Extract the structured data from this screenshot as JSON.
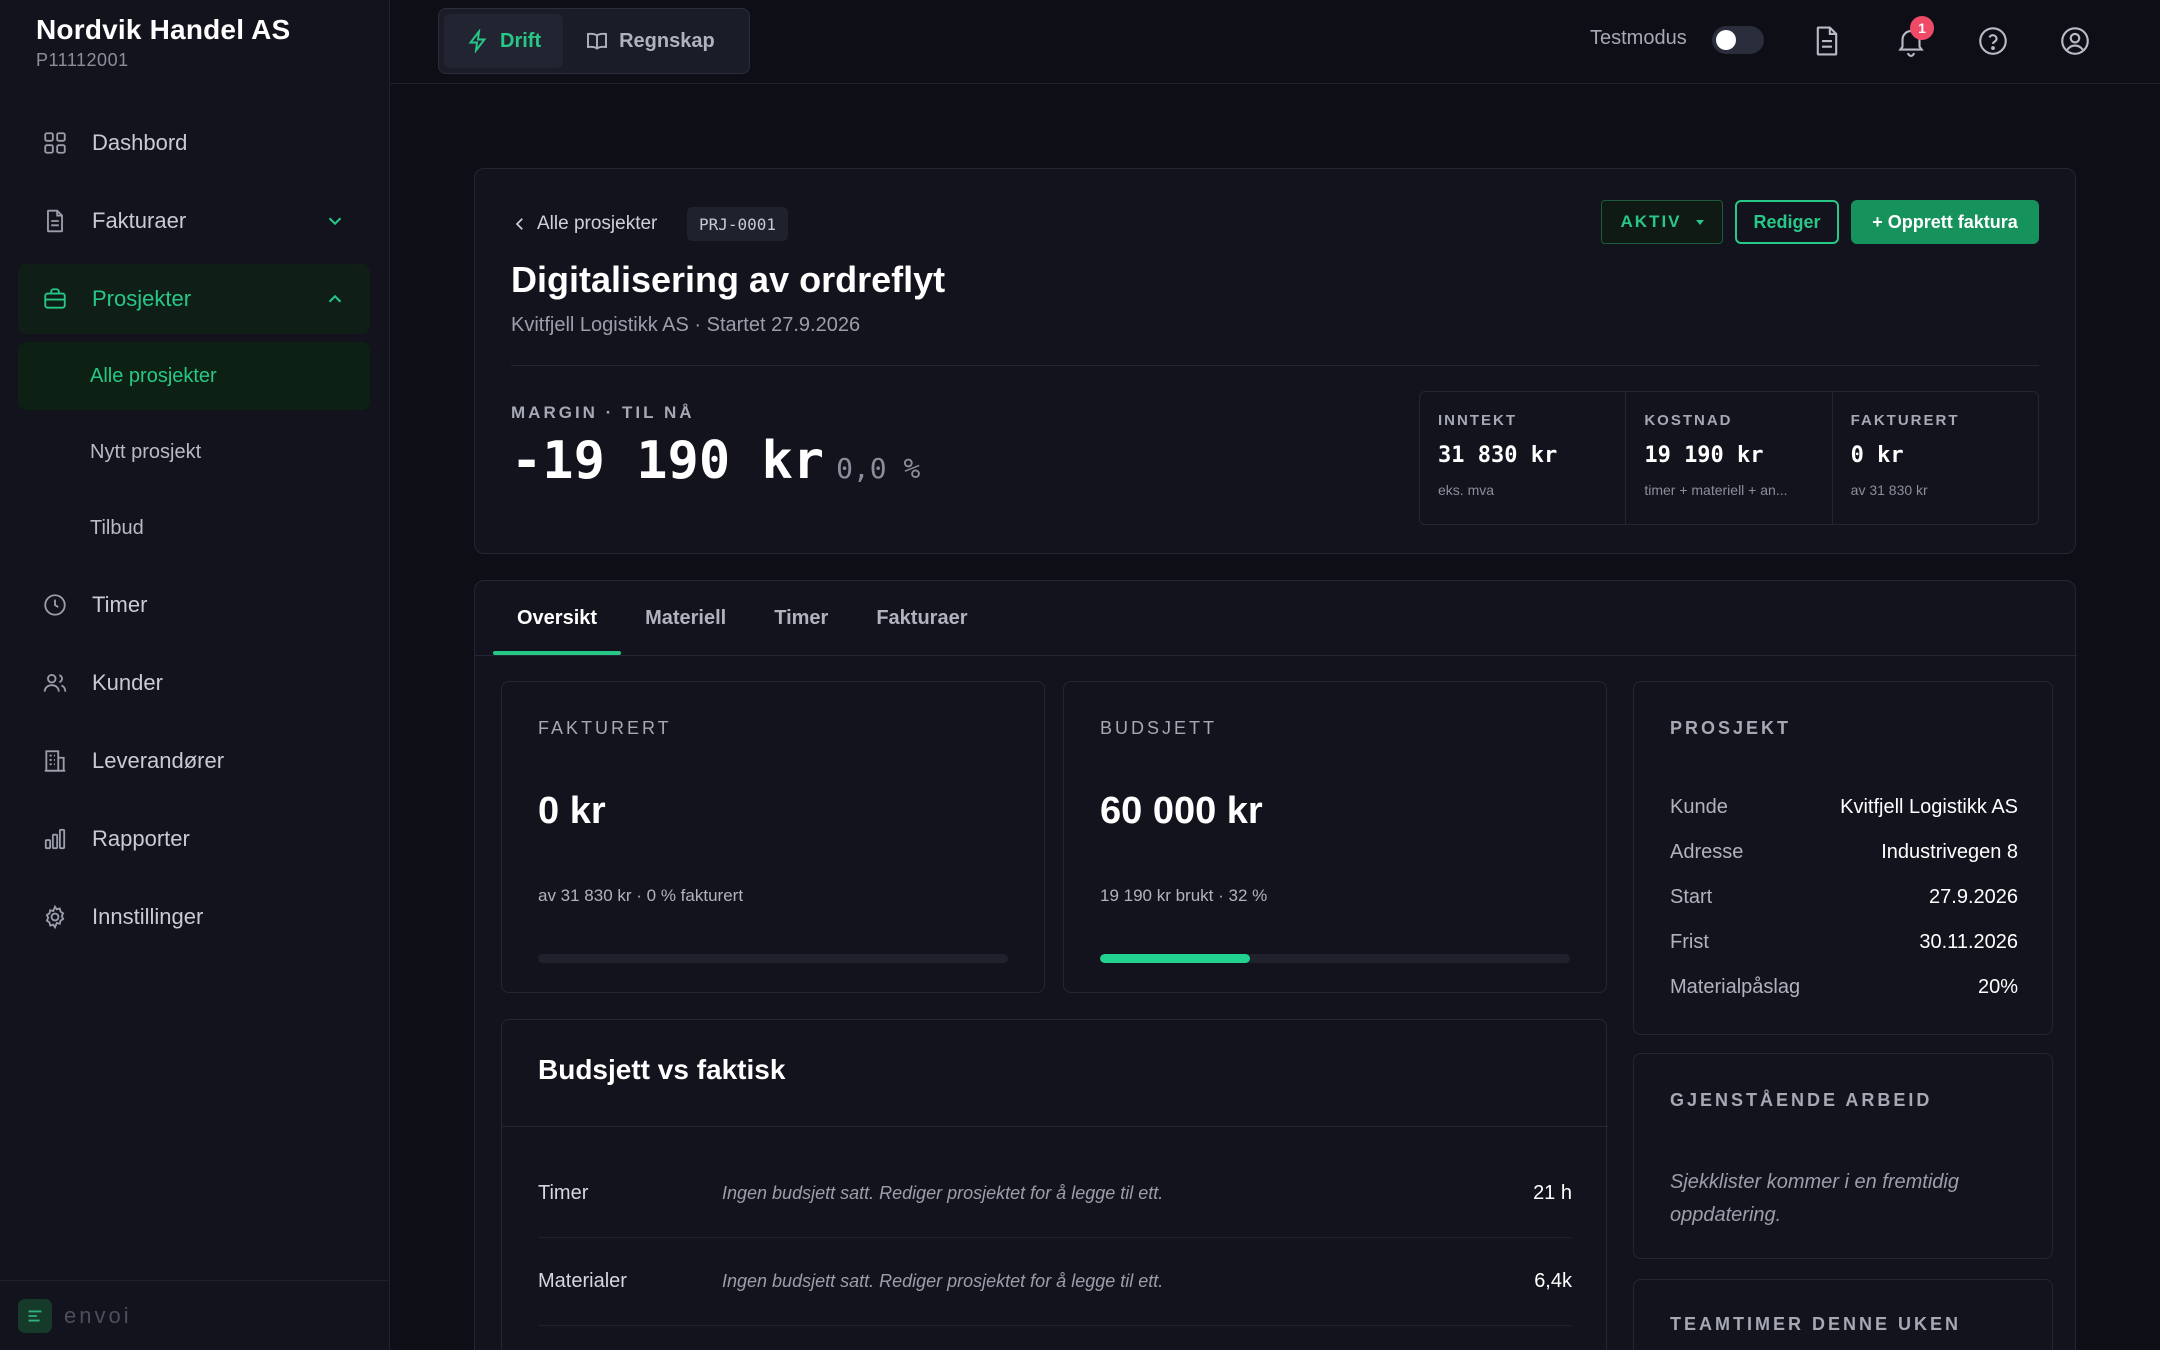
{
  "company": {
    "name": "Nordvik Handel AS",
    "id": "P11112001"
  },
  "sidebar": {
    "items": [
      {
        "label": "Dashbord",
        "icon": "grid-icon"
      },
      {
        "label": "Fakturaer",
        "icon": "document-icon"
      },
      {
        "label": "Prosjekter",
        "icon": "briefcase-icon"
      },
      {
        "label": "Timer",
        "icon": "clock-icon"
      },
      {
        "label": "Kunder",
        "icon": "users-icon"
      },
      {
        "label": "Leverandører",
        "icon": "building-icon"
      },
      {
        "label": "Rapporter",
        "icon": "bar-chart-icon"
      },
      {
        "label": "Innstillinger",
        "icon": "gear-icon"
      }
    ],
    "subitems": [
      "Alle prosjekter",
      "Nytt prosjekt",
      "Tilbud"
    ],
    "footer": "envoi"
  },
  "topbar": {
    "modes": [
      "Drift",
      "Regnskap"
    ],
    "test_label": "Testmodus",
    "notification_count": "1"
  },
  "project": {
    "back_label": "Alle prosjekter",
    "code": "PRJ-0001",
    "title": "Digitalisering av ordreflyt",
    "subtitle": "Kvitfjell Logistikk AS · Startet 27.9.2026",
    "status": "AKTIV",
    "edit_label": "Rediger",
    "create_label": "+ Opprett faktura",
    "margin_label": "MARGIN · TIL NÅ",
    "margin_amount": "-19 190 kr",
    "margin_pct": "0,0 %"
  },
  "kpis": [
    {
      "label": "INNTEKT",
      "value": "31 830 kr",
      "note": "eks. mva"
    },
    {
      "label": "KOSTNAD",
      "value": "19 190 kr",
      "note": "timer + materiell + an..."
    },
    {
      "label": "FAKTURERT",
      "value": "0 kr",
      "note": "av 31 830 kr"
    }
  ],
  "tabs": [
    "Oversikt",
    "Materiell",
    "Timer",
    "Fakturaer"
  ],
  "stats": {
    "invoiced": {
      "label": "FAKTURERT",
      "value": "0 kr",
      "note": "av 31 830 kr · 0 % fakturert",
      "progress_pct": 0
    },
    "budget": {
      "label": "BUDSJETT",
      "value": "60 000 kr",
      "note": "19 190 kr brukt · 32 %",
      "progress_pct": 32
    }
  },
  "budget_vs_actual": {
    "title": "Budsjett vs faktisk",
    "rows": [
      {
        "name": "Timer",
        "message": "Ingen budsjett satt. Rediger prosjektet for å legge til ett.",
        "value": "21 h"
      },
      {
        "name": "Materialer",
        "message": "Ingen budsjett satt. Rediger prosjektet for å legge til ett.",
        "value": "6,4k"
      }
    ]
  },
  "project_info": {
    "title": "PROSJEKT",
    "rows": [
      {
        "key": "Kunde",
        "value": "Kvitfjell Logistikk AS"
      },
      {
        "key": "Adresse",
        "value": "Industrivegen 8"
      },
      {
        "key": "Start",
        "value": "27.9.2026"
      },
      {
        "key": "Frist",
        "value": "30.11.2026"
      },
      {
        "key": "Materialpåslag",
        "value": "20%"
      }
    ]
  },
  "remaining_work": {
    "title": "GJENSTÅENDE ARBEID",
    "message": "Sjekklister kommer i en fremtidig oppdatering."
  },
  "team_hours": {
    "title": "TEAMTIMER DENNE UKEN"
  },
  "colors": {
    "accent": "#27c887",
    "background": "#0d0e16",
    "panel": "#12131c",
    "badge": "#ef4a66"
  }
}
